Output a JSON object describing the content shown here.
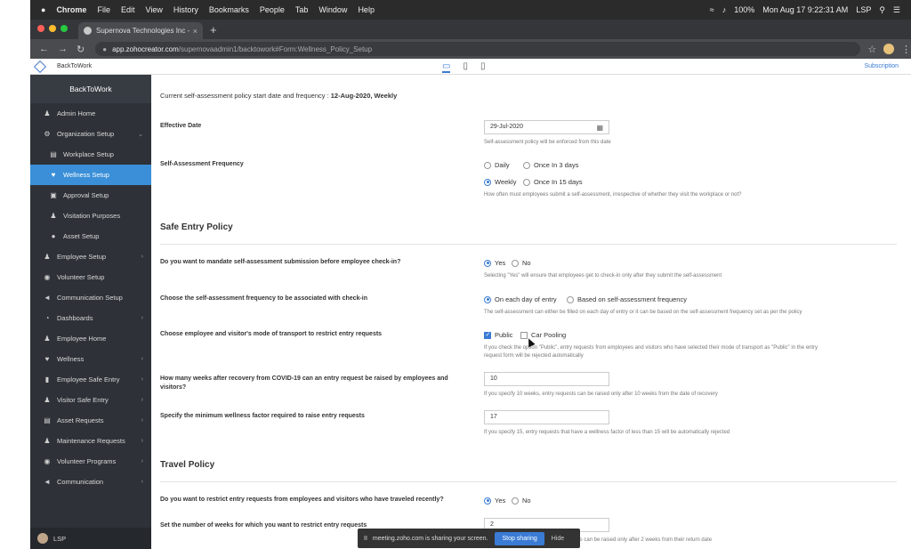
{
  "menubar": {
    "apple": "",
    "items": [
      "Chrome",
      "File",
      "Edit",
      "View",
      "History",
      "Bookmarks",
      "People",
      "Tab",
      "Window",
      "Help"
    ],
    "battery": "100%",
    "datetime": "Mon Aug 17  9:22:31 AM",
    "user": "LSP"
  },
  "browser": {
    "tab_title": "Supernova Technologies Inc - ",
    "tab_close": "×",
    "new_tab": "+",
    "url_host": "app.zohocreator.com",
    "url_path": "/supernovaadmin1/backtowork#Form:Wellness_Policy_Setup"
  },
  "app": {
    "name": "BackToWork",
    "subscription": "Subscription"
  },
  "sidebar": {
    "brand": "BackToWork",
    "items": [
      {
        "label": "Admin Home",
        "icon": "users-icon"
      },
      {
        "label": "Organization Setup",
        "icon": "gear-icon"
      },
      {
        "label": "Workplace Setup",
        "icon": "building-icon"
      },
      {
        "label": "Wellness Setup",
        "icon": "heart-icon"
      },
      {
        "label": "Approval Setup",
        "icon": "clipboard-icon"
      },
      {
        "label": "Visitation Purposes",
        "icon": "person-icon"
      },
      {
        "label": "Asset Setup",
        "icon": "lock-icon"
      },
      {
        "label": "Employee Setup",
        "icon": "group-icon"
      },
      {
        "label": "Volunteer Setup",
        "icon": "volunteer-icon"
      },
      {
        "label": "Communication Setup",
        "icon": "megaphone-icon"
      },
      {
        "label": "Dashboards",
        "icon": "pie-icon"
      },
      {
        "label": "Employee Home",
        "icon": "person-icon"
      },
      {
        "label": "Wellness",
        "icon": "heart-icon"
      },
      {
        "label": "Employee Safe Entry",
        "icon": "door-icon"
      },
      {
        "label": "Visitor Safe Entry",
        "icon": "visitor-icon"
      },
      {
        "label": "Asset Requests",
        "icon": "desk-icon"
      },
      {
        "label": "Maintenance Requests",
        "icon": "worker-icon"
      },
      {
        "label": "Volunteer Programs",
        "icon": "volunteer-icon"
      },
      {
        "label": "Communication",
        "icon": "megaphone-icon"
      }
    ],
    "footer_user": "LSP"
  },
  "form": {
    "current_policy_prefix": "Current self-assessment policy start date and frequency : ",
    "current_policy_value": "12-Aug-2020, Weekly",
    "effective_date_label": "Effective Date",
    "effective_date_value": "29-Jul-2020",
    "effective_date_help": "Self-assessment policy will be enforced from this date",
    "frequency_label": "Self-Assessment Frequency",
    "freq_options": [
      "Daily",
      "Once In 3 days",
      "Weekly",
      "Once In 15 days"
    ],
    "frequency_help": "How often must employees submit a self-assessment, irrespective of whether they visit the workplace or not?",
    "safe_entry_title": "Safe Entry Policy",
    "mandate_label": "Do you want to mandate self-assessment submission before employee check-in?",
    "yes": "Yes",
    "no": "No",
    "mandate_help": "Selecting \"Yes\" will ensure that employees get to check-in only after they submit the self-assessment",
    "checkin_label": "Choose the self-assessment frequency to be associated with check-in",
    "checkin_options": [
      "On each day of entry",
      "Based on self-assessment frequency"
    ],
    "checkin_help": "The self-assessment can either be filled on each day of entry or it can be based on the self-assessment frequency set as per the policy",
    "transport_label": "Choose employee and visitor's mode of transport to restrict entry requests",
    "transport_options": [
      "Public",
      "Car Pooling"
    ],
    "transport_help_1": "If you check the option \"Public\", entry requests from employees and visitors who have selected their mode of transport as \"Public\" in the entry",
    "transport_help_2": "request form will be rejected automatically",
    "recovery_label_1": "How many weeks after recovery from COVID-19 can an entry request be raised by employees and",
    "recovery_label_2": "visitors?",
    "recovery_value": "10",
    "recovery_help": "If you specify 10 weeks, entry requests can be raised only after 10 weeks from the date of recovery",
    "wellness_label": "Specify the minimum wellness factor required to raise entry requests",
    "wellness_value": "17",
    "wellness_help": "If you specify 15, entry requests that have a wellness factor of less than 15 will be automatically rejected",
    "travel_title": "Travel Policy",
    "travel_label": "Do you want to restrict entry requests from employees and visitors who have traveled recently?",
    "weeks_label": "Set the number of weeks for which you want to restrict entry requests",
    "weeks_value": "2",
    "weeks_help": "ts can be raised only after 2 weeks from their return date"
  },
  "share_bar": {
    "pause": "II",
    "text": "meeting.zoho.com is sharing your screen.",
    "stop": "Stop sharing",
    "hide": "Hide"
  }
}
